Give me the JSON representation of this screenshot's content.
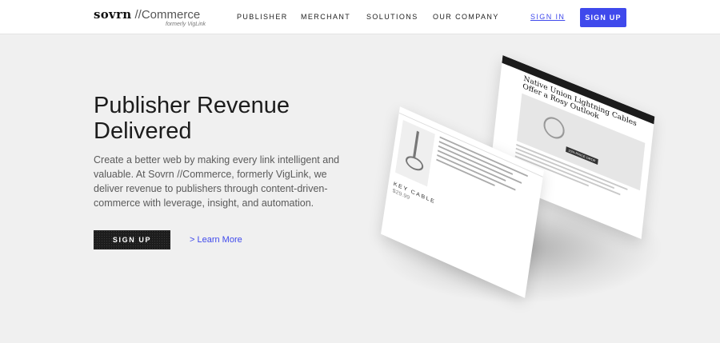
{
  "nav": {
    "logo": {
      "brand": "sovrn",
      "product": "//Commerce",
      "subtitle": "formerly VigLink"
    },
    "links": [
      "PUBLISHER",
      "MERCHANT",
      "SOLUTIONS",
      "OUR COMPANY"
    ],
    "sign_in": "SIGN IN",
    "sign_up": "SIGN UP"
  },
  "hero": {
    "title_line1": "Publisher Revenue",
    "title_line2": "Delivered",
    "description": "Create a better web by making every link intelligent and valuable. At Sovrn //Commerce, formerly VigLink, we deliver revenue to publishers through content-driven-commerce with leverage, insight, and automation.",
    "cta_button": "SIGN UP",
    "learn_more": "> Learn More"
  },
  "mockup": {
    "back_phone": {
      "headline": "Native Union Lightning Cables Offer a Rosy Outlook",
      "tag": "15% PRICE DROP"
    },
    "front_phone": {
      "label": "KEY CABLE",
      "price": "$29.99"
    }
  },
  "colors": {
    "accent": "#3f49ec",
    "background": "#f0f0f0",
    "dark_button": "#1d1d1d"
  }
}
